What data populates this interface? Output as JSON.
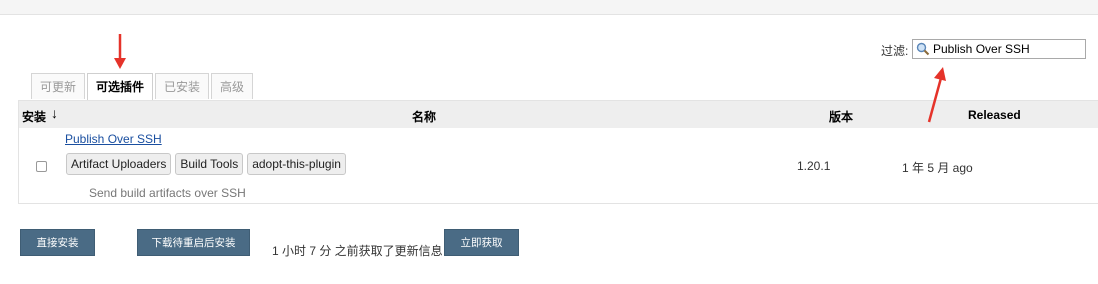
{
  "filter": {
    "label": "过滤:",
    "value": "Publish Over SSH",
    "icon": "search-icon"
  },
  "tabs": [
    {
      "label": "可更新",
      "active": false
    },
    {
      "label": "可选插件",
      "active": true
    },
    {
      "label": "已安装",
      "active": false
    },
    {
      "label": "高级",
      "active": false
    }
  ],
  "table": {
    "headers": {
      "install": "安装",
      "sort_arrow": "↓",
      "name": "名称",
      "version": "版本",
      "released": "Released"
    },
    "rows": [
      {
        "checked": false,
        "name": "Publish Over SSH",
        "labels": [
          "Artifact Uploaders",
          "Build Tools",
          "adopt-this-plugin"
        ],
        "description": "Send build artifacts over SSH",
        "version": "1.20.1",
        "released": "1 年 5 月 ago"
      }
    ]
  },
  "buttons": {
    "install": "直接安装",
    "download_restart": "下载待重启后安装",
    "fetch_now": "立即获取"
  },
  "update_info": "1 小时 7 分 之前获取了更新信息",
  "annotation_color": "#e5332a"
}
